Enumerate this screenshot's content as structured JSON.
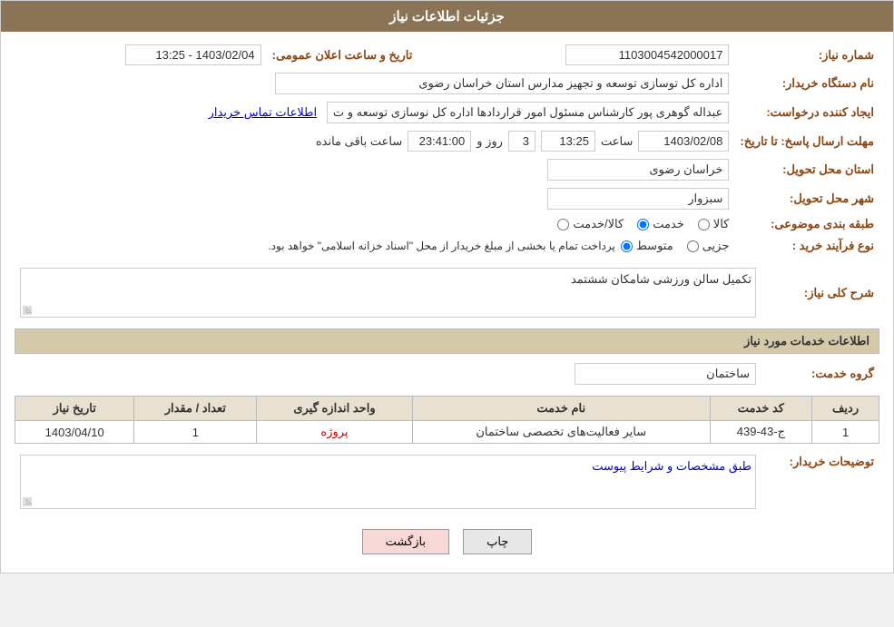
{
  "header": {
    "title": "جزئیات اطلاعات نیاز"
  },
  "fields": {
    "shomareNiaz_label": "شماره نیاز:",
    "shomareNiaz_value": "1103004542000017",
    "namDastgah_label": "نام دستگاه خریدار:",
    "namDastgah_value": "اداره کل توسازی  توسعه و تجهیز مدارس استان خراسان رضوی",
    "ijadKonande_label": "ایجاد کننده درخواست:",
    "ijadKonande_value": "عبداله گوهری پور کارشناس مسئول امور قراردادها  اداره کل نوسازی  توسعه و ت",
    "ijadKonande_link": "اطلاعات تماس خریدار",
    "mohlatErsal_label": "مهلت ارسال پاسخ: تا تاریخ:",
    "date_value": "1403/02/08",
    "time_label": "ساعت",
    "time_value": "13:25",
    "roz_label": "روز و",
    "roz_value": "3",
    "remaining_value": "23:41:00",
    "remaining_label": "ساعت باقی مانده",
    "ostan_label": "استان محل تحویل:",
    "ostan_value": "خراسان رضوی",
    "shahr_label": "شهر محل تحویل:",
    "shahr_value": "سبزوار",
    "tabaqe_label": "طبقه بندی موضوعی:",
    "tabaqe_options": [
      "کالا",
      "خدمت",
      "کالا/خدمت"
    ],
    "tabaqe_selected": "خدمت",
    "noeFarayand_label": "نوع فرآیند خرید :",
    "noeFarayand_options": [
      "جزیی",
      "متوسط"
    ],
    "noeFarayand_selected": "متوسط",
    "noeFarayand_note": "پرداخت تمام یا بخشی از مبلغ خریدار از محل \"اسناد خزانه اسلامی\" خواهد بود.",
    "tarikho_label": "تاریخ و ساعت اعلان عمومی:",
    "tarikho_value": "1403/02/04 - 13:25",
    "sharh_label": "شرح کلی نیاز:",
    "sharh_value": "تکمیل سالن ورزشی شامکان ششتمد",
    "services_header": "اطلاعات خدمات مورد نیاز",
    "gerohKhadamat_label": "گروه خدمت:",
    "gerohKhadamat_value": "ساختمان",
    "table_headers": [
      "ردیف",
      "کد خدمت",
      "نام خدمت",
      "واحد اندازه گیری",
      "تعداد / مقدار",
      "تاریخ نیاز"
    ],
    "table_rows": [
      {
        "radif": "1",
        "kodKhadamat": "ج-43-439",
        "namKhadamat": "سایر فعالیت‌های تخصصی ساختمان",
        "vahed": "پروژه",
        "tedad": "1",
        "tarikh": "1403/04/10"
      }
    ],
    "tozihat_label": "توضیحات خریدار:",
    "tozihat_value": "طبق مشخصات و شرایط پیوست",
    "btn_print": "چاپ",
    "btn_back": "بازگشت"
  }
}
